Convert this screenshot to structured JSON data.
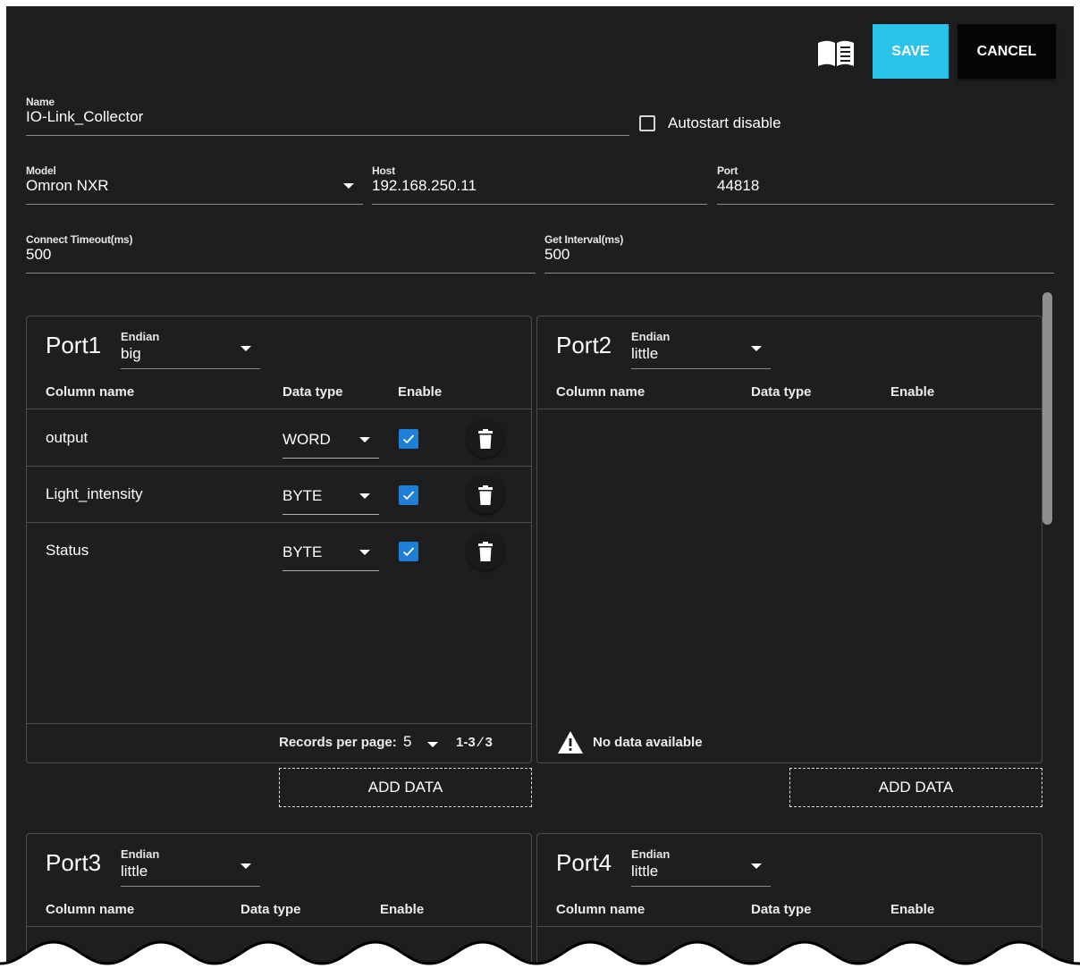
{
  "toolbar": {
    "manual_icon": "book-icon",
    "save_label": "SAVE",
    "cancel_label": "CANCEL"
  },
  "form": {
    "name": {
      "label": "Name",
      "value": "IO-Link_Collector"
    },
    "autostart": {
      "label": "Autostart disable",
      "checked": false
    },
    "model": {
      "label": "Model",
      "value": "Omron NXR"
    },
    "host": {
      "label": "Host",
      "value": "192.168.250.11"
    },
    "port": {
      "label": "Port",
      "value": "44818"
    },
    "connect_timeout": {
      "label": "Connect Timeout(ms)",
      "value": "500"
    },
    "get_interval": {
      "label": "Get Interval(ms)",
      "value": "500"
    }
  },
  "columns": {
    "name": "Column name",
    "data_type": "Data type",
    "enable": "Enable"
  },
  "ports": [
    {
      "title": "Port1",
      "endian_label": "Endian",
      "endian": "big",
      "rows": [
        {
          "name": "output",
          "data_type": "WORD",
          "enabled": true
        },
        {
          "name": "Light_intensity",
          "data_type": "BYTE",
          "enabled": true
        },
        {
          "name": "Status",
          "data_type": "BYTE",
          "enabled": true
        }
      ],
      "records_per_page_label": "Records per page:",
      "records_per_page": "5",
      "range": "1-3 ∕ 3",
      "add_label": "ADD DATA"
    },
    {
      "title": "Port2",
      "endian_label": "Endian",
      "endian": "little",
      "rows": [],
      "no_data": "No data available",
      "add_label": "ADD DATA"
    },
    {
      "title": "Port3",
      "endian_label": "Endian",
      "endian": "little"
    },
    {
      "title": "Port4",
      "endian_label": "Endian",
      "endian": "little"
    }
  ],
  "colors": {
    "accent": "#2cc3ea",
    "checkbox": "#1e7ed8",
    "background": "#1e1e1e"
  }
}
